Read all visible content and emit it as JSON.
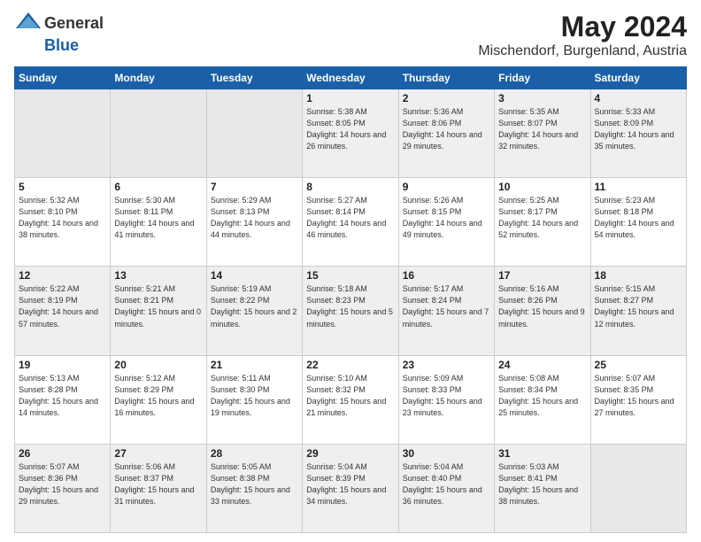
{
  "header": {
    "logo_general": "General",
    "logo_blue": "Blue",
    "title": "May 2024",
    "location": "Mischendorf, Burgenland, Austria"
  },
  "weekdays": [
    "Sunday",
    "Monday",
    "Tuesday",
    "Wednesday",
    "Thursday",
    "Friday",
    "Saturday"
  ],
  "weeks": [
    [
      {
        "day": "",
        "empty": true
      },
      {
        "day": "",
        "empty": true
      },
      {
        "day": "",
        "empty": true
      },
      {
        "day": "1",
        "sunrise": "5:38 AM",
        "sunset": "8:05 PM",
        "daylight": "14 hours and 26 minutes."
      },
      {
        "day": "2",
        "sunrise": "5:36 AM",
        "sunset": "8:06 PM",
        "daylight": "14 hours and 29 minutes."
      },
      {
        "day": "3",
        "sunrise": "5:35 AM",
        "sunset": "8:07 PM",
        "daylight": "14 hours and 32 minutes."
      },
      {
        "day": "4",
        "sunrise": "5:33 AM",
        "sunset": "8:09 PM",
        "daylight": "14 hours and 35 minutes."
      }
    ],
    [
      {
        "day": "5",
        "sunrise": "5:32 AM",
        "sunset": "8:10 PM",
        "daylight": "14 hours and 38 minutes."
      },
      {
        "day": "6",
        "sunrise": "5:30 AM",
        "sunset": "8:11 PM",
        "daylight": "14 hours and 41 minutes."
      },
      {
        "day": "7",
        "sunrise": "5:29 AM",
        "sunset": "8:13 PM",
        "daylight": "14 hours and 44 minutes."
      },
      {
        "day": "8",
        "sunrise": "5:27 AM",
        "sunset": "8:14 PM",
        "daylight": "14 hours and 46 minutes."
      },
      {
        "day": "9",
        "sunrise": "5:26 AM",
        "sunset": "8:15 PM",
        "daylight": "14 hours and 49 minutes."
      },
      {
        "day": "10",
        "sunrise": "5:25 AM",
        "sunset": "8:17 PM",
        "daylight": "14 hours and 52 minutes."
      },
      {
        "day": "11",
        "sunrise": "5:23 AM",
        "sunset": "8:18 PM",
        "daylight": "14 hours and 54 minutes."
      }
    ],
    [
      {
        "day": "12",
        "sunrise": "5:22 AM",
        "sunset": "8:19 PM",
        "daylight": "14 hours and 57 minutes."
      },
      {
        "day": "13",
        "sunrise": "5:21 AM",
        "sunset": "8:21 PM",
        "daylight": "15 hours and 0 minutes."
      },
      {
        "day": "14",
        "sunrise": "5:19 AM",
        "sunset": "8:22 PM",
        "daylight": "15 hours and 2 minutes."
      },
      {
        "day": "15",
        "sunrise": "5:18 AM",
        "sunset": "8:23 PM",
        "daylight": "15 hours and 5 minutes."
      },
      {
        "day": "16",
        "sunrise": "5:17 AM",
        "sunset": "8:24 PM",
        "daylight": "15 hours and 7 minutes."
      },
      {
        "day": "17",
        "sunrise": "5:16 AM",
        "sunset": "8:26 PM",
        "daylight": "15 hours and 9 minutes."
      },
      {
        "day": "18",
        "sunrise": "5:15 AM",
        "sunset": "8:27 PM",
        "daylight": "15 hours and 12 minutes."
      }
    ],
    [
      {
        "day": "19",
        "sunrise": "5:13 AM",
        "sunset": "8:28 PM",
        "daylight": "15 hours and 14 minutes."
      },
      {
        "day": "20",
        "sunrise": "5:12 AM",
        "sunset": "8:29 PM",
        "daylight": "15 hours and 16 minutes."
      },
      {
        "day": "21",
        "sunrise": "5:11 AM",
        "sunset": "8:30 PM",
        "daylight": "15 hours and 19 minutes."
      },
      {
        "day": "22",
        "sunrise": "5:10 AM",
        "sunset": "8:32 PM",
        "daylight": "15 hours and 21 minutes."
      },
      {
        "day": "23",
        "sunrise": "5:09 AM",
        "sunset": "8:33 PM",
        "daylight": "15 hours and 23 minutes."
      },
      {
        "day": "24",
        "sunrise": "5:08 AM",
        "sunset": "8:34 PM",
        "daylight": "15 hours and 25 minutes."
      },
      {
        "day": "25",
        "sunrise": "5:07 AM",
        "sunset": "8:35 PM",
        "daylight": "15 hours and 27 minutes."
      }
    ],
    [
      {
        "day": "26",
        "sunrise": "5:07 AM",
        "sunset": "8:36 PM",
        "daylight": "15 hours and 29 minutes."
      },
      {
        "day": "27",
        "sunrise": "5:06 AM",
        "sunset": "8:37 PM",
        "daylight": "15 hours and 31 minutes."
      },
      {
        "day": "28",
        "sunrise": "5:05 AM",
        "sunset": "8:38 PM",
        "daylight": "15 hours and 33 minutes."
      },
      {
        "day": "29",
        "sunrise": "5:04 AM",
        "sunset": "8:39 PM",
        "daylight": "15 hours and 34 minutes."
      },
      {
        "day": "30",
        "sunrise": "5:04 AM",
        "sunset": "8:40 PM",
        "daylight": "15 hours and 36 minutes."
      },
      {
        "day": "31",
        "sunrise": "5:03 AM",
        "sunset": "8:41 PM",
        "daylight": "15 hours and 38 minutes."
      },
      {
        "day": "",
        "empty": true
      }
    ]
  ],
  "labels": {
    "sunrise": "Sunrise:",
    "sunset": "Sunset:",
    "daylight": "Daylight:"
  }
}
